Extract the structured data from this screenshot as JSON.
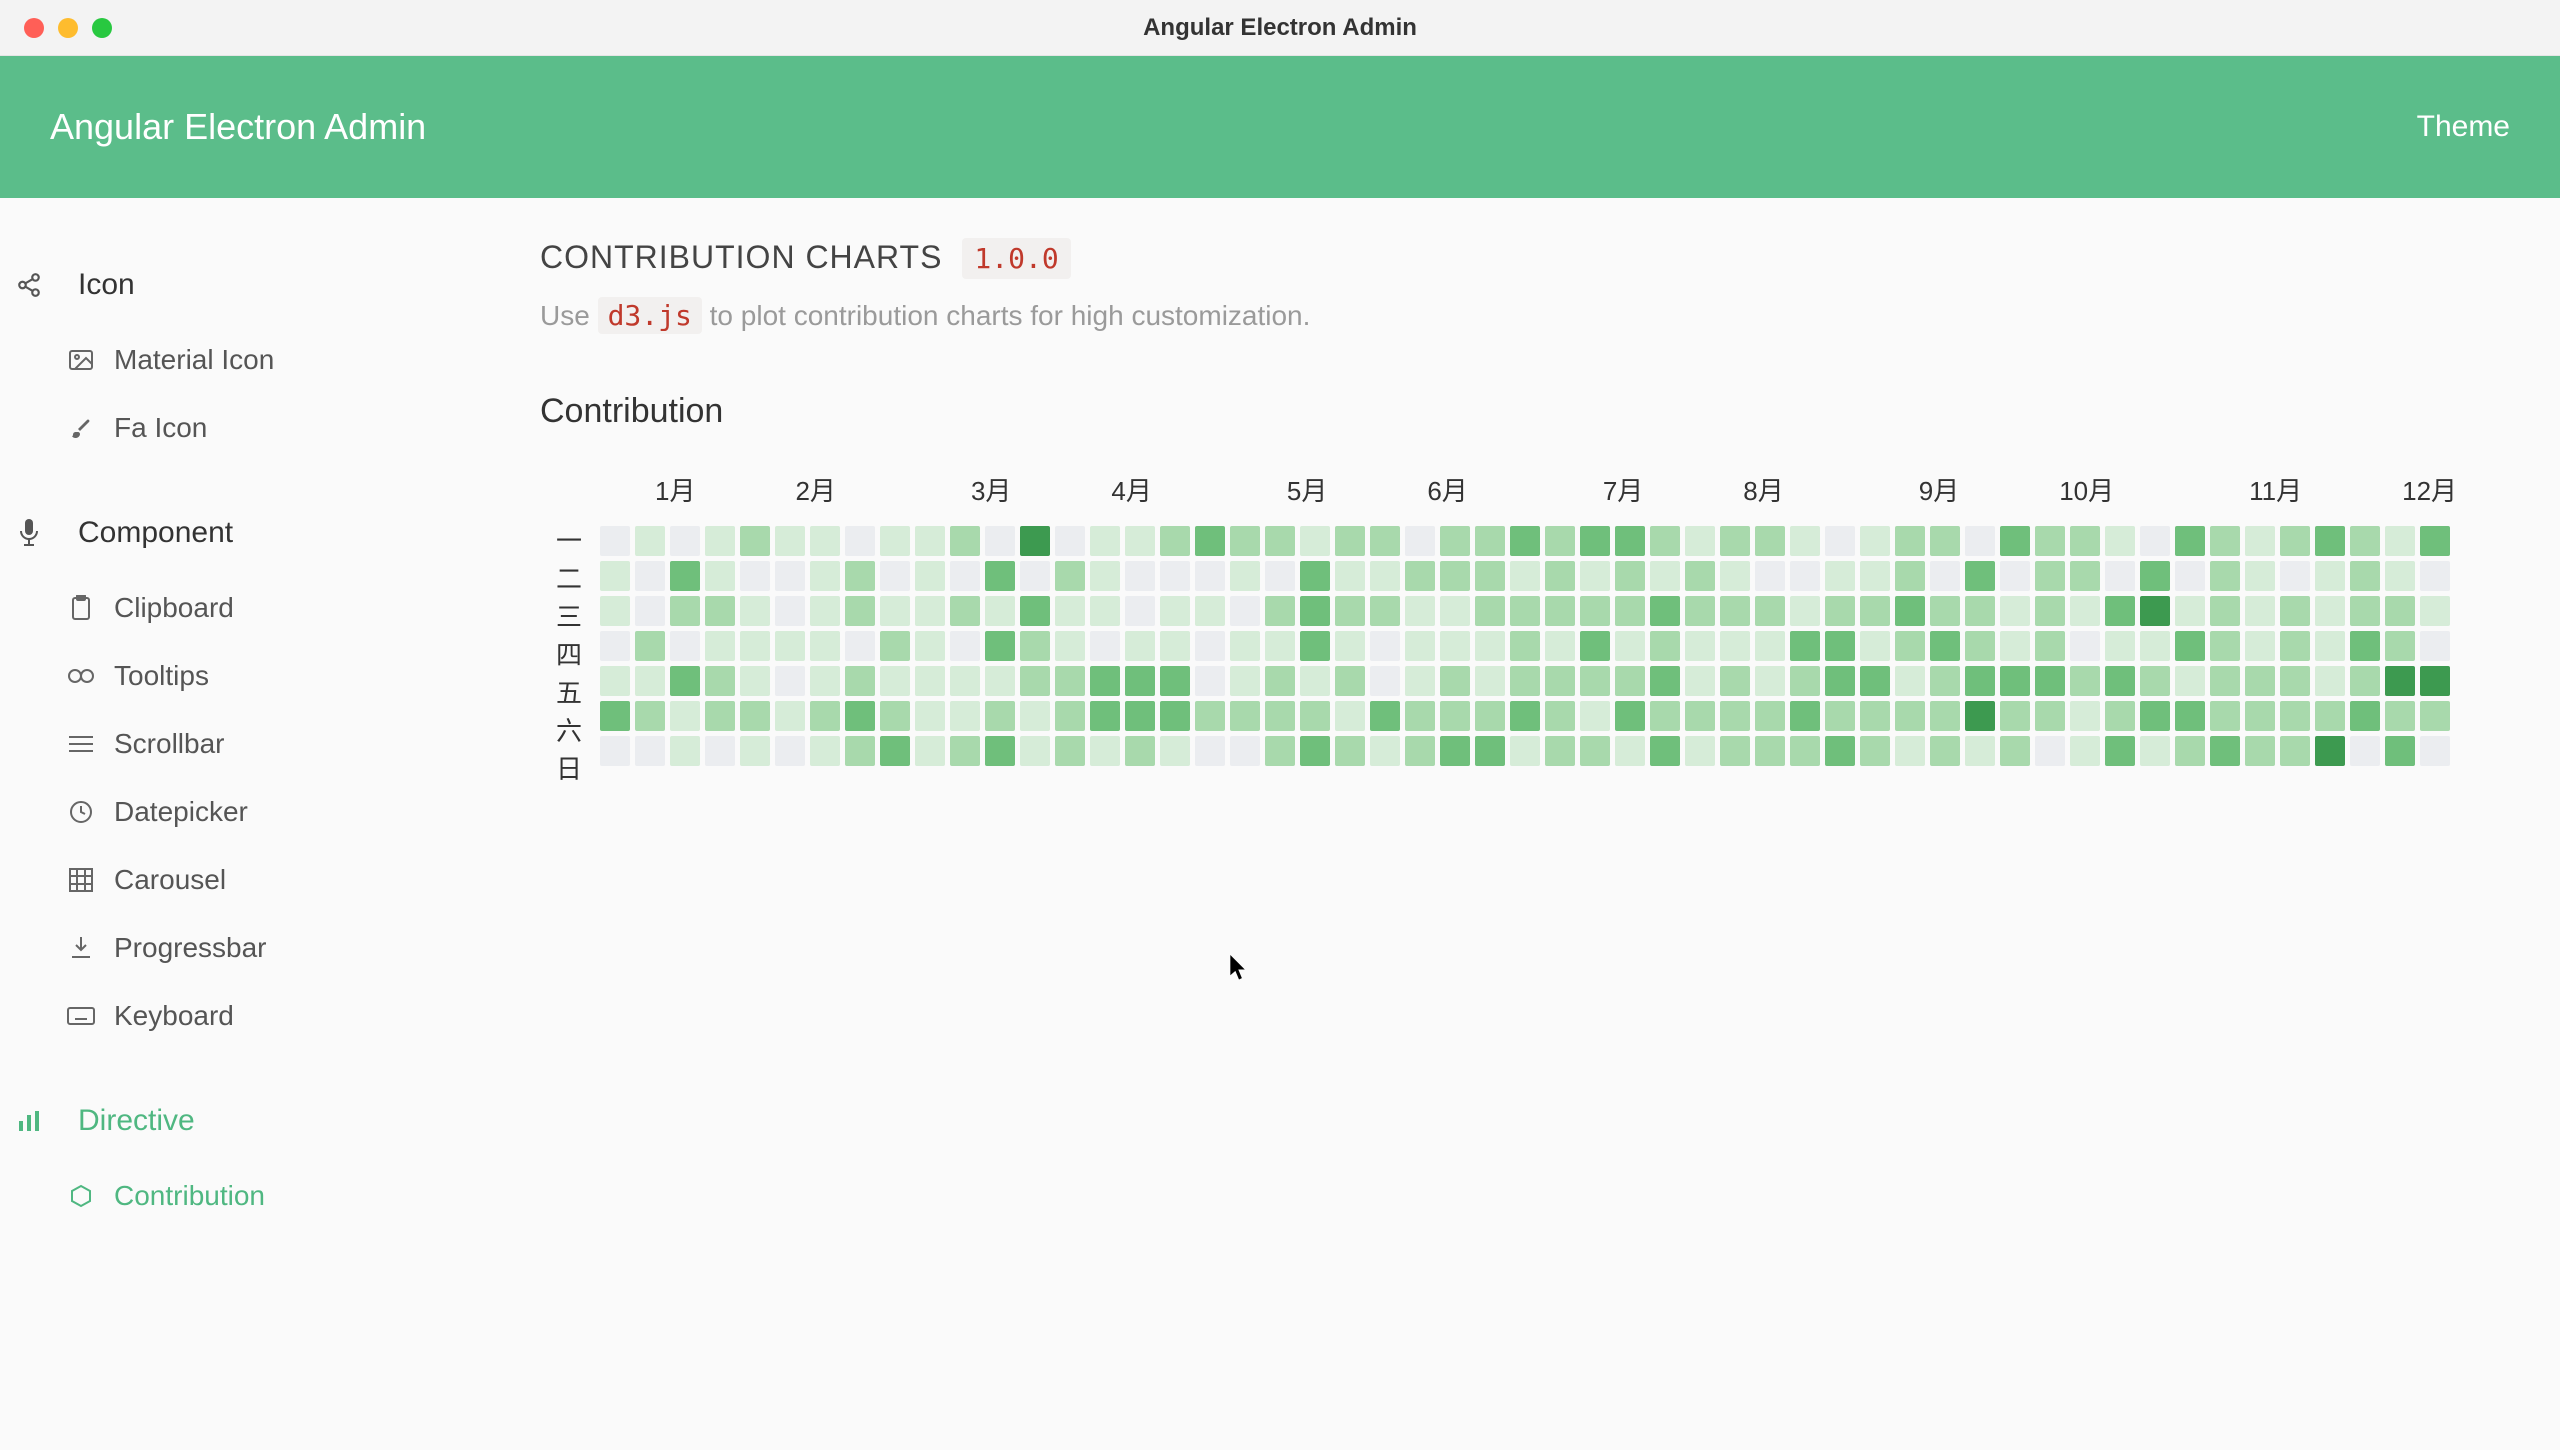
{
  "window": {
    "title": "Angular Electron Admin"
  },
  "header": {
    "brand": "Angular Electron Admin",
    "theme_label": "Theme"
  },
  "sidebar": {
    "sections": [
      {
        "label": "Icon",
        "icon": "share-icon",
        "items": [
          {
            "label": "Material Icon",
            "icon": "image-icon"
          },
          {
            "label": "Fa Icon",
            "icon": "brush-icon"
          }
        ]
      },
      {
        "label": "Component",
        "icon": "mic-icon",
        "items": [
          {
            "label": "Clipboard",
            "icon": "clipboard-icon"
          },
          {
            "label": "Tooltips",
            "icon": "link-icon"
          },
          {
            "label": "Scrollbar",
            "icon": "bars-icon"
          },
          {
            "label": "Datepicker",
            "icon": "clock-icon"
          },
          {
            "label": "Carousel",
            "icon": "grid-icon"
          },
          {
            "label": "Progressbar",
            "icon": "download-icon"
          },
          {
            "label": "Keyboard",
            "icon": "keyboard-icon"
          }
        ]
      },
      {
        "label": "Directive",
        "icon": "chart-icon",
        "active": true,
        "items": [
          {
            "label": "Contribution",
            "icon": "hexagon-icon",
            "active": true
          }
        ]
      }
    ]
  },
  "page": {
    "title": "CONTRIBUTION CHARTS",
    "version": "1.0.0",
    "subtitle_pre": "Use ",
    "subtitle_code": "d3.js",
    "subtitle_post": " to plot contribution charts for high customization.",
    "section_label": "Contribution"
  },
  "chart_data": {
    "type": "heatmap",
    "title": "Contribution",
    "x_labels": [
      "1月",
      "2月",
      "3月",
      "4月",
      "5月",
      "6月",
      "7月",
      "8月",
      "9月",
      "10月",
      "11月",
      "12月"
    ],
    "y_labels": [
      "一",
      "二",
      "三",
      "四",
      "五",
      "六",
      "日"
    ],
    "month_label_positions_weeks": [
      1,
      5,
      10,
      14,
      19,
      23,
      28,
      32,
      37,
      41,
      46,
      50
    ],
    "intensity_scale": {
      "min": 0,
      "max": 4,
      "colors": [
        "#ebedf0",
        "#d6ecd8",
        "#a8d9ac",
        "#6fbf7b",
        "#3d9a50"
      ]
    },
    "weeks": 53,
    "values_row_major": [
      [
        0,
        1,
        0,
        1,
        2,
        1,
        1,
        0,
        1,
        1,
        2,
        0,
        4,
        0,
        1,
        1,
        2,
        3,
        2,
        2,
        1,
        2,
        2,
        0,
        2,
        2,
        3,
        2,
        3,
        3,
        2,
        1,
        2,
        2,
        1,
        0,
        1,
        2,
        2,
        0,
        3,
        2,
        2,
        1,
        0,
        3,
        2,
        1,
        2,
        3,
        2,
        1,
        3
      ],
      [
        1,
        0,
        3,
        1,
        0,
        0,
        1,
        2,
        0,
        1,
        0,
        3,
        0,
        2,
        1,
        0,
        0,
        0,
        1,
        0,
        3,
        1,
        1,
        2,
        2,
        2,
        1,
        2,
        1,
        2,
        1,
        2,
        1,
        0,
        0,
        1,
        1,
        2,
        0,
        3,
        0,
        2,
        2,
        0,
        3,
        0,
        2,
        1,
        0,
        1,
        2,
        1,
        0
      ],
      [
        1,
        0,
        2,
        2,
        1,
        0,
        1,
        2,
        1,
        1,
        2,
        1,
        3,
        1,
        1,
        0,
        1,
        1,
        0,
        2,
        3,
        2,
        2,
        1,
        1,
        2,
        2,
        2,
        2,
        2,
        3,
        2,
        2,
        2,
        1,
        2,
        2,
        3,
        2,
        2,
        1,
        2,
        1,
        3,
        4,
        1,
        2,
        1,
        2,
        1,
        2,
        2,
        1
      ],
      [
        0,
        2,
        0,
        1,
        1,
        1,
        1,
        0,
        2,
        1,
        0,
        3,
        2,
        1,
        0,
        1,
        1,
        0,
        1,
        1,
        3,
        1,
        0,
        1,
        1,
        1,
        2,
        1,
        3,
        1,
        2,
        1,
        1,
        1,
        3,
        3,
        1,
        2,
        3,
        2,
        1,
        2,
        0,
        1,
        1,
        3,
        2,
        1,
        2,
        1,
        3,
        2,
        0
      ],
      [
        1,
        1,
        3,
        2,
        1,
        0,
        1,
        2,
        1,
        1,
        1,
        1,
        2,
        2,
        3,
        3,
        3,
        0,
        1,
        2,
        1,
        2,
        0,
        1,
        2,
        1,
        2,
        2,
        2,
        2,
        3,
        1,
        2,
        1,
        2,
        3,
        3,
        1,
        2,
        3,
        3,
        3,
        2,
        3,
        2,
        1,
        2,
        2,
        2,
        1,
        2,
        4,
        4
      ],
      [
        3,
        2,
        1,
        2,
        2,
        1,
        2,
        3,
        2,
        1,
        1,
        2,
        1,
        2,
        3,
        3,
        3,
        2,
        2,
        2,
        2,
        1,
        3,
        2,
        2,
        2,
        3,
        2,
        1,
        3,
        2,
        2,
        2,
        2,
        3,
        2,
        2,
        2,
        2,
        4,
        2,
        2,
        1,
        2,
        3,
        3,
        2,
        2,
        2,
        2,
        3,
        2,
        2
      ],
      [
        0,
        0,
        1,
        0,
        1,
        0,
        1,
        2,
        3,
        1,
        2,
        3,
        1,
        2,
        1,
        2,
        1,
        0,
        0,
        2,
        3,
        2,
        1,
        2,
        3,
        3,
        1,
        2,
        2,
        1,
        3,
        1,
        2,
        2,
        2,
        3,
        2,
        1,
        2,
        1,
        2,
        0,
        1,
        3,
        1,
        2,
        3,
        2,
        2,
        4,
        0,
        3,
        0
      ]
    ]
  }
}
